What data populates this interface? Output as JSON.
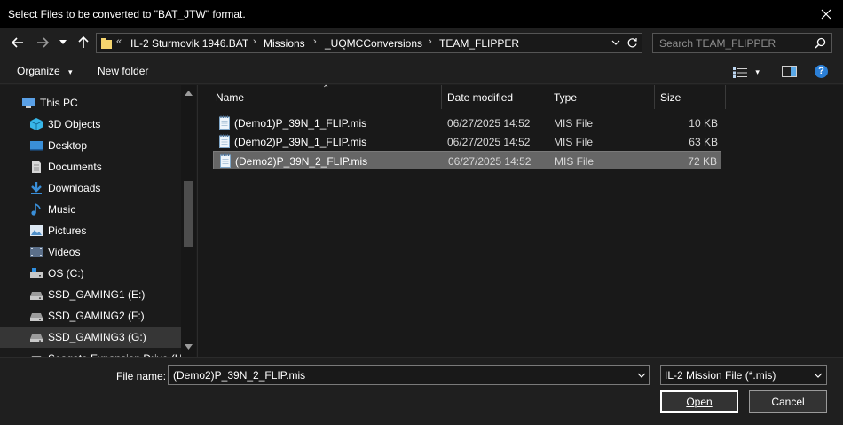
{
  "window": {
    "title": "Select Files to be converted to \"BAT_JTW\" format.",
    "close_glyph": "✕"
  },
  "nav": {
    "back_glyph": "←",
    "forward_glyph": "→",
    "recent_glyph": "▾",
    "up_glyph": "↑"
  },
  "address": {
    "overflow": "«",
    "crumbs": [
      "IL-2 Sturmovik 1946.BAT",
      "Missions",
      "_UQMCConversions",
      "TEAM_FLIPPER"
    ],
    "separator": "›",
    "dropdown_glyph": "⌄",
    "refresh_glyph": "↻"
  },
  "search": {
    "placeholder": "Search TEAM_FLIPPER",
    "icon": "search-icon"
  },
  "toolbar": {
    "organize_label": "Organize",
    "organize_caret": "▾",
    "new_folder_label": "New folder",
    "view_caret": "▾",
    "help_glyph": "?"
  },
  "sidebar": {
    "items": [
      {
        "label": "This PC",
        "icon": "computer-icon",
        "color": "#5aa0e6"
      },
      {
        "label": "3D Objects",
        "icon": "cube-icon",
        "color": "#38b6e8"
      },
      {
        "label": "Desktop",
        "icon": "desktop-icon",
        "color": "#3a8fd8"
      },
      {
        "label": "Documents",
        "icon": "document-icon",
        "color": "#d6d6d6"
      },
      {
        "label": "Downloads",
        "icon": "download-icon",
        "color": "#3a8fd8"
      },
      {
        "label": "Music",
        "icon": "music-icon",
        "color": "#3a8fd8"
      },
      {
        "label": "Pictures",
        "icon": "pictures-icon",
        "color": "#8fb7dc"
      },
      {
        "label": "Videos",
        "icon": "videos-icon",
        "color": "#8fa0b8"
      },
      {
        "label": "OS (C:)",
        "icon": "drive-os-icon",
        "color": "#c8c8c8"
      },
      {
        "label": "SSD_GAMING1 (E:)",
        "icon": "drive-icon",
        "color": "#c8c8c8"
      },
      {
        "label": "SSD_GAMING2 (F:)",
        "icon": "drive-icon",
        "color": "#c8c8c8"
      },
      {
        "label": "SSD_GAMING3 (G:)",
        "icon": "drive-icon",
        "color": "#c8c8c8"
      },
      {
        "label": "Seagate Expansion Drive (H:)",
        "icon": "drive-icon",
        "color": "#c8c8c8"
      }
    ],
    "selected_index": 11
  },
  "columns": {
    "sort_glyph": "⌃",
    "name": "Name",
    "date": "Date modified",
    "type": "Type",
    "size": "Size"
  },
  "files": [
    {
      "name": "(Demo1)P_39N_1_FLIP.mis",
      "date": "06/27/2025 14:52",
      "type": "MIS File",
      "size": "10 KB"
    },
    {
      "name": "(Demo2)P_39N_1_FLIP.mis",
      "date": "06/27/2025 14:52",
      "type": "MIS File",
      "size": "63 KB"
    },
    {
      "name": "(Demo2)P_39N_2_FLIP.mis",
      "date": "06/27/2025 14:52",
      "type": "MIS File",
      "size": "72 KB"
    }
  ],
  "selected_file_index": 2,
  "bottom": {
    "file_name_label": "File name:",
    "file_name_value": "(Demo2)P_39N_2_FLIP.mis",
    "file_type": "IL-2 Mission File (*.mis)",
    "dropdown_glyph": "⌄",
    "open_label": "Open",
    "cancel_label": "Cancel"
  }
}
